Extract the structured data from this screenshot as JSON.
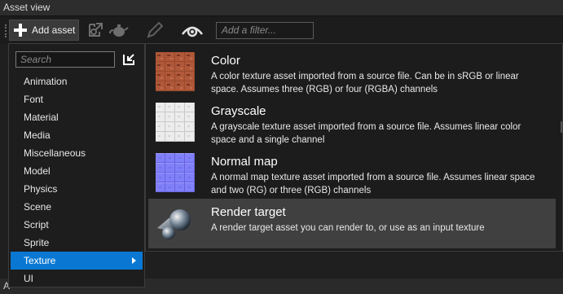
{
  "window": {
    "title": "Asset view"
  },
  "toolbar": {
    "add_asset_label": "Add asset",
    "filter_placeholder": "Add a filter..."
  },
  "menu": {
    "search_placeholder": "Search",
    "items": [
      {
        "label": "Animation"
      },
      {
        "label": "Font"
      },
      {
        "label": "Material"
      },
      {
        "label": "Media"
      },
      {
        "label": "Miscellaneous"
      },
      {
        "label": "Model"
      },
      {
        "label": "Physics"
      },
      {
        "label": "Scene"
      },
      {
        "label": "Script"
      },
      {
        "label": "Sprite"
      },
      {
        "label": "Texture",
        "selected": true
      },
      {
        "label": "UI"
      }
    ]
  },
  "texture_types": [
    {
      "title": "Color",
      "description": "A color texture asset imported from a source file. Can be in sRGB or linear space. Assumes three (RGB) or four (RGBA) channels",
      "icon": "color-texture-thumbnail"
    },
    {
      "title": "Grayscale",
      "description": "A grayscale texture asset imported from a source file. Assumes linear color space and a single channel",
      "icon": "grayscale-texture-thumbnail"
    },
    {
      "title": "Normal map",
      "description": "A normal map texture asset imported from a source file. Assumes linear space and two (RG) or three (RGB) channels",
      "icon": "normal-map-thumbnail"
    },
    {
      "title": "Render target",
      "description": "A render target asset you can render to, or use as an input texture",
      "icon": "render-target-thumbnail"
    }
  ],
  "bottom_panel": {
    "label": "A"
  },
  "colors": {
    "selection": "#0a78d2",
    "hover": "#404040",
    "background": "#1c1c1c"
  }
}
